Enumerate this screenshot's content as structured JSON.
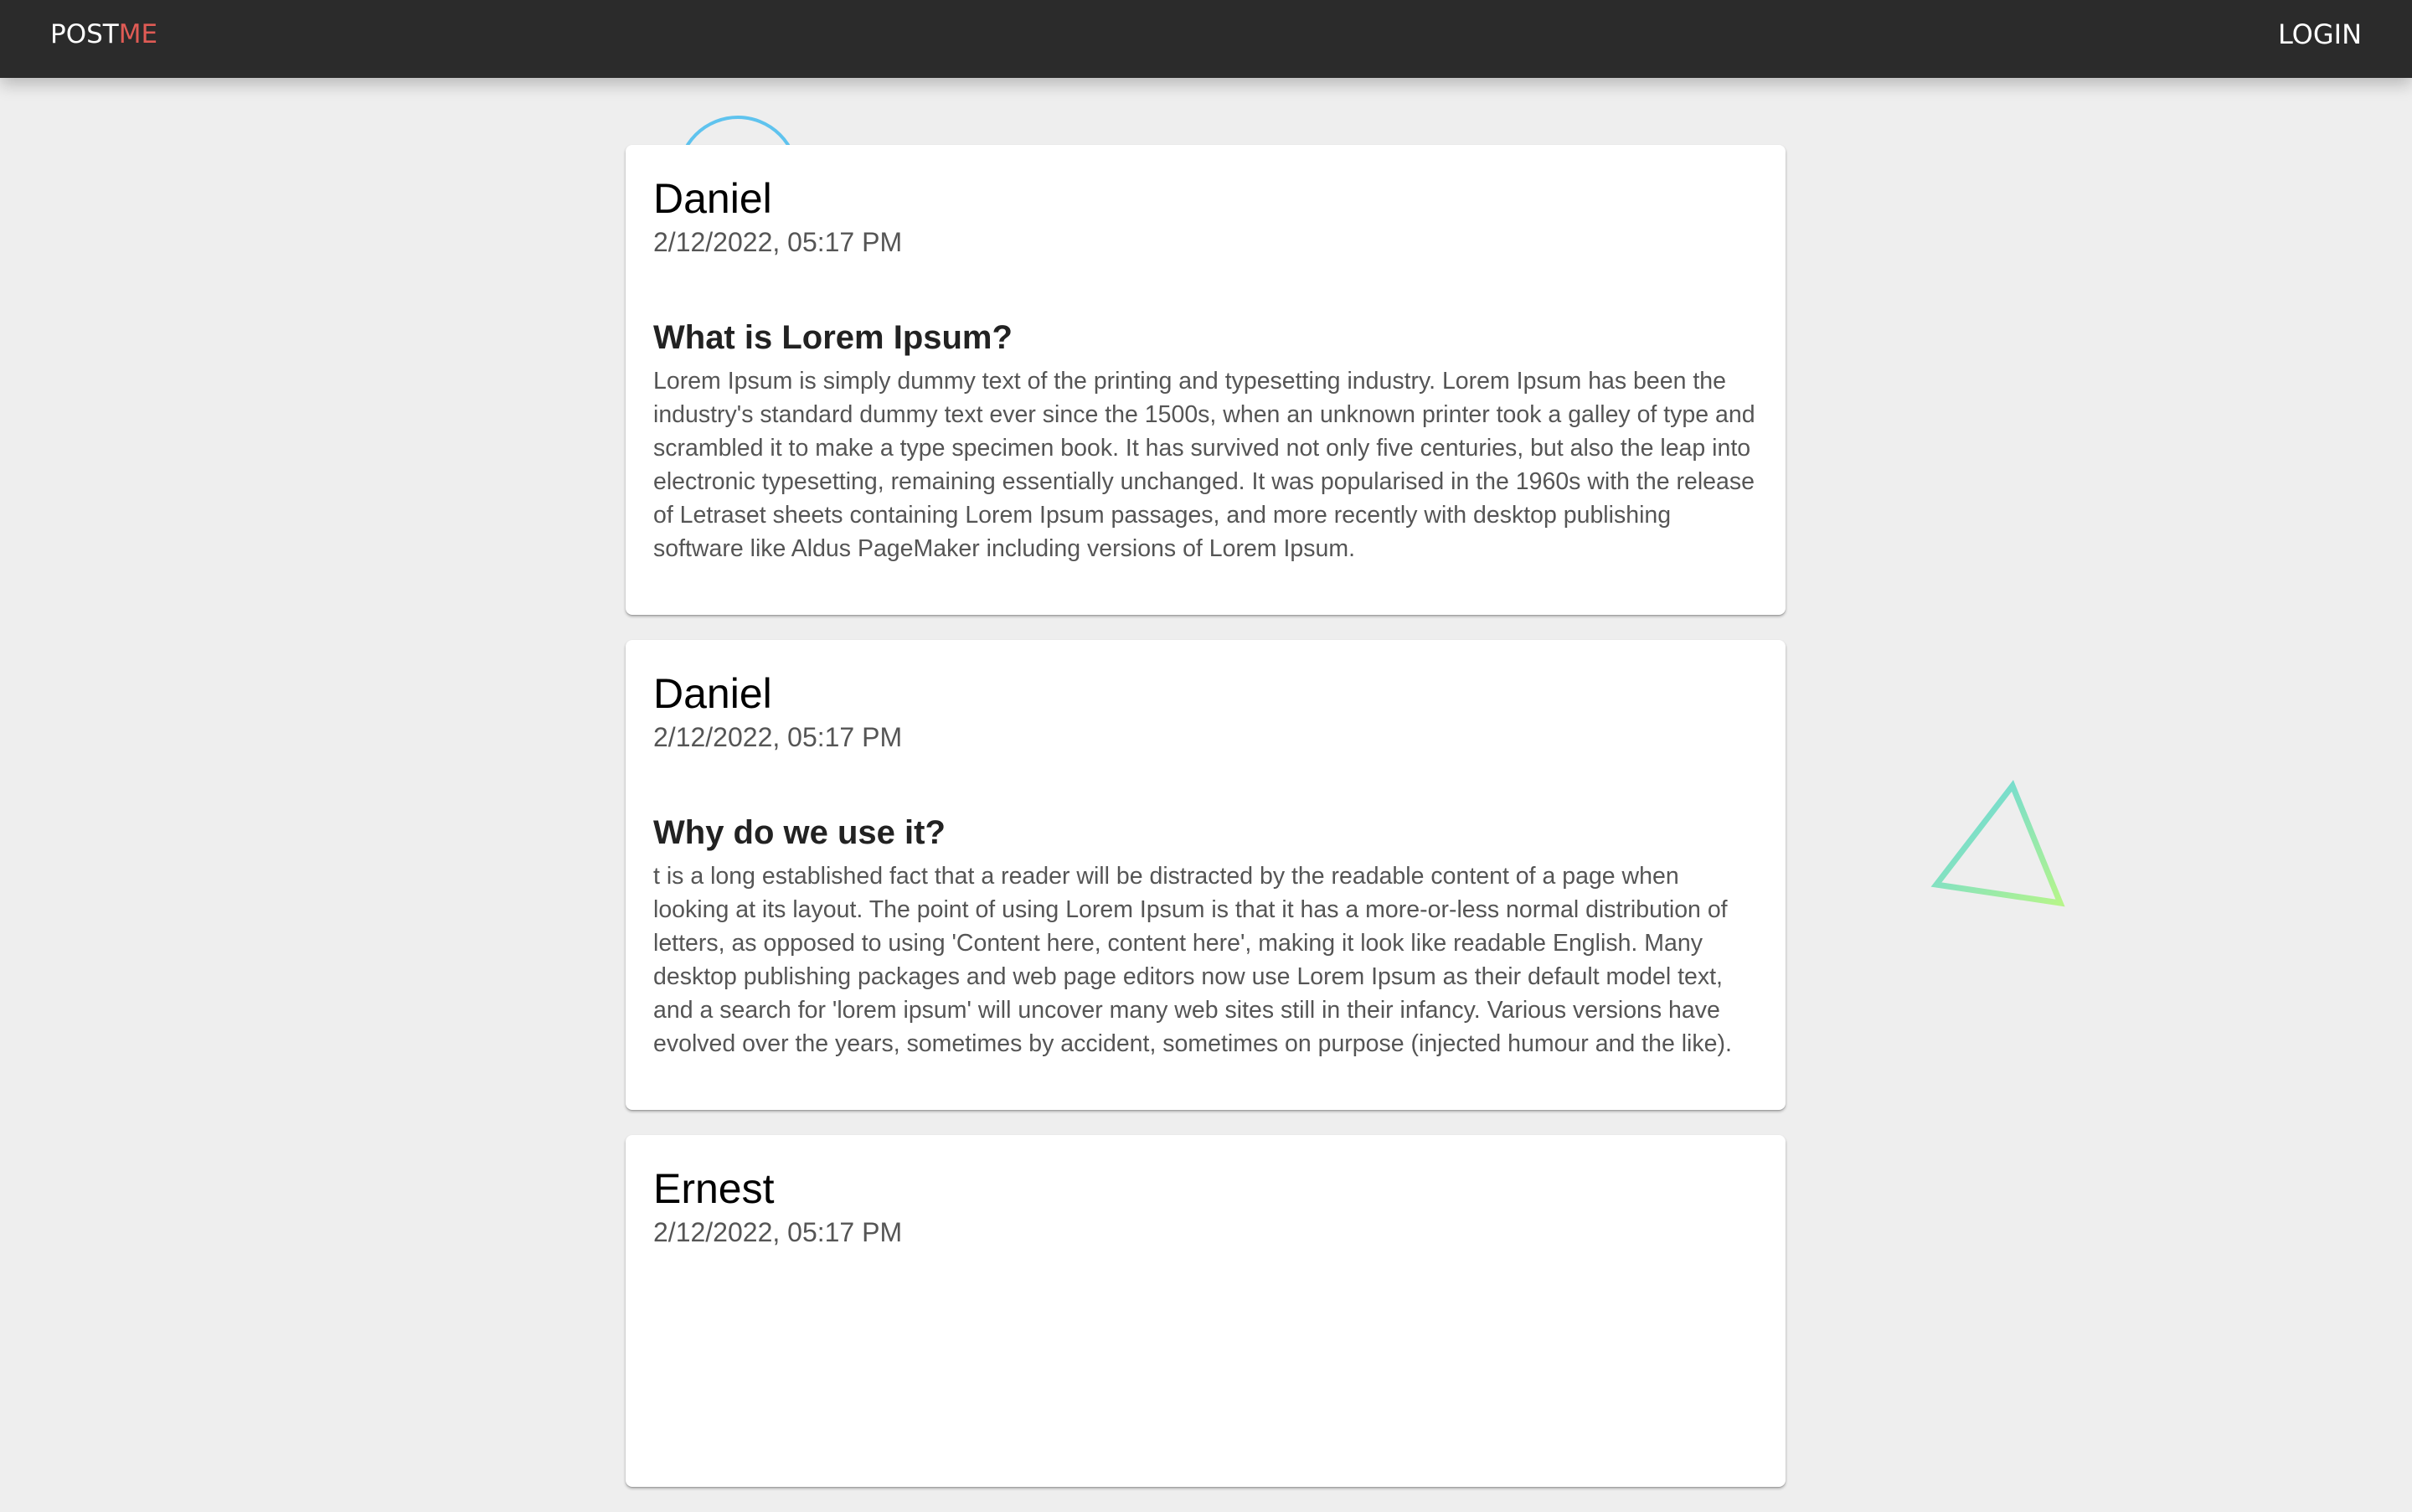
{
  "navbar": {
    "logo_part1": "POST",
    "logo_part2": "ME",
    "login_label": "LOGIN",
    "logo_accent_color": "#e05b55",
    "background_color": "#2b2b2b"
  },
  "posts": [
    {
      "author": "Daniel",
      "timestamp": "2/12/2022, 05:17 PM",
      "title": "What is Lorem Ipsum?",
      "body": "Lorem Ipsum is simply dummy text of the printing and typesetting industry. Lorem Ipsum has been the industry's standard dummy text ever since the 1500s, when an unknown printer took a galley of type and scrambled it to make a type specimen book. It has survived not only five centuries, but also the leap into electronic typesetting, remaining essentially unchanged. It was popularised in the 1960s with the release of Letraset sheets containing Lorem Ipsum passages, and more recently with desktop publishing software like Aldus PageMaker including versions of Lorem Ipsum."
    },
    {
      "author": "Daniel",
      "timestamp": "2/12/2022, 05:17 PM",
      "title": "Why do we use it?",
      "body": "t is a long established fact that a reader will be distracted by the readable content of a page when looking at its layout. The point of using Lorem Ipsum is that it has a more-or-less normal distribution of letters, as opposed to using 'Content here, content here', making it look like readable English. Many desktop publishing packages and web page editors now use Lorem Ipsum as their default model text, and a search for 'lorem ipsum' will uncover many web sites still in their infancy. Various versions have evolved over the years, sometimes by accident, sometimes on purpose (injected humour and the like)."
    },
    {
      "author": "Ernest",
      "timestamp": "2/12/2022, 05:17 PM",
      "title": "",
      "body": ""
    }
  ],
  "decorations": {
    "circle_color": "#5fc3ee",
    "triangle_gradient": [
      "#5fd3e8",
      "#b6f58a"
    ]
  }
}
